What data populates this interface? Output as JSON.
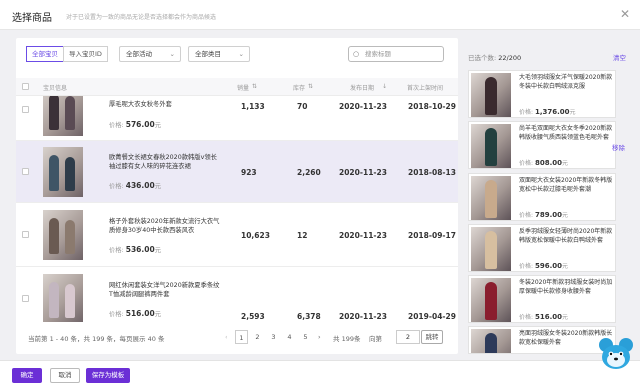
{
  "header": {
    "title": "选择商品",
    "subtitle": "对于已设置为一致的商品无论是否选择都会作为商品候选",
    "close_icon": "close-icon"
  },
  "toolbar": {
    "tabs": [
      {
        "label": "全部宝贝",
        "active": true
      },
      {
        "label": "导入宝贝ID",
        "active": false
      }
    ],
    "activity_select": "全部活动",
    "category_select": "全部类目",
    "search_placeholder": "搜索标题"
  },
  "table": {
    "columns": {
      "info": "宝贝信息",
      "sales": "销量",
      "stock": "库存",
      "date": "发布日期",
      "last_time": "首次上架时间"
    },
    "price_label": "价格:",
    "rows": [
      {
        "name": "厚毛呢大衣女秋冬外套",
        "price": "576.00",
        "price_suffix": "元",
        "sales": "1,133",
        "stock": "70",
        "date": "2020-11-23",
        "last": "2018-10-29"
      },
      {
        "name": "欧菁餐文长裙女春秋2020款韩版v领长袖过膝有女人味的碎花连衣裙",
        "price": "436.00",
        "price_suffix": "元",
        "sales": "923",
        "stock": "2,260",
        "date": "2020-11-23",
        "last": "2018-08-13"
      },
      {
        "name": "格子外套秋装2020年新款女流行大衣气质修身30岁40中长款西装风衣",
        "price": "536.00",
        "price_suffix": "元",
        "sales": "10,623",
        "stock": "12",
        "date": "2020-11-23",
        "last": "2018-09-17"
      },
      {
        "name": "网红休闲套装女洋气2020新款夏季条纹T恤减龄阔腿裤两件套",
        "price": "516.00",
        "price_suffix": "元",
        "sales": "2,593",
        "stock": "6,378",
        "date": "2020-11-23",
        "last": "2019-04-29"
      }
    ]
  },
  "pager": {
    "summary": "当前第 1 - 40 条，共 199 条，每页展示 40 条",
    "pages": [
      "1",
      "2",
      "3",
      "4",
      "5"
    ],
    "prev": "‹",
    "next": "›",
    "total": "共 199条",
    "goto_label": "向第",
    "goto_value": "2",
    "goto_unit": "页",
    "goto_btn": "跳转"
  },
  "selected": {
    "label": "已选个数:",
    "count": "22/200",
    "clear": "清空",
    "remove": "移除",
    "items": [
      {
        "name": "大毛领羽绒服女洋气保暖2020新款冬装中长款白鸭绒派克服",
        "price": "1,376.00",
        "suffix": "元",
        "color": "#3a2a2e"
      },
      {
        "name": "尚羊毛双面呢大衣女冬季2020新款韩版收腰气质西装领蓝色毛呢外套",
        "price": "808.00",
        "suffix": "元",
        "color": "#23403f"
      },
      {
        "name": "双面呢大衣女装2020年新款冬韩版宽松中长款过膝毛呢外套潮",
        "price": "789.00",
        "suffix": "元",
        "color": "#c8aa8c"
      },
      {
        "name": "反季羽绒服女轻薄时尚2020年新款韩版宽松保暖中长款白鸭绒外套",
        "price": "596.00",
        "suffix": "元",
        "color": "#d7bfa0"
      },
      {
        "name": "冬装2020年新款羽绒服女装时尚加厚保暖中长款修身收腰外套",
        "price": "516.00",
        "suffix": "元",
        "color": "#8a1e2e"
      },
      {
        "name": "亮面羽绒服女冬装2020新款韩版长款宽松保暖外套",
        "price": "",
        "suffix": "",
        "color": "#2d3a5a"
      }
    ]
  },
  "footer": {
    "confirm": "确定",
    "cancel": "取消",
    "save_template": "保存为模板"
  },
  "colors": {
    "accent": "#6b4ce6",
    "primary_button": "#6b2fd6"
  }
}
